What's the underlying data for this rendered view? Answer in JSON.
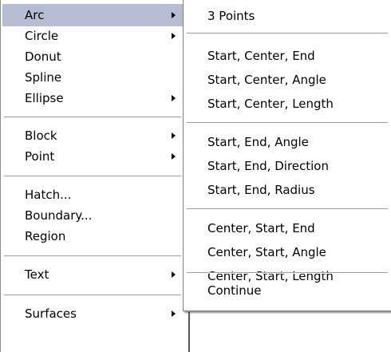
{
  "draw_menu": {
    "items": [
      {
        "label": "Arc",
        "submenu": true,
        "selected": true
      },
      {
        "label": "Circle",
        "submenu": true
      },
      {
        "label": "Donut"
      },
      {
        "label": "Spline"
      },
      {
        "label": "Ellipse",
        "submenu": true
      },
      {
        "label": "Block",
        "submenu": true
      },
      {
        "label": "Point",
        "submenu": true
      },
      {
        "label": "Hatch..."
      },
      {
        "label": "Boundary..."
      },
      {
        "label": "Region"
      },
      {
        "label": "Text",
        "submenu": true
      },
      {
        "label": "Surfaces",
        "submenu": true
      }
    ],
    "selected_color": "#b6bdd2"
  },
  "arc_submenu": {
    "items": [
      {
        "label": "3 Points"
      },
      {
        "label": "Start, Center, End"
      },
      {
        "label": "Start, Center, Angle"
      },
      {
        "label": "Start, Center, Length"
      },
      {
        "label": "Start, End, Angle"
      },
      {
        "label": "Start, End, Direction"
      },
      {
        "label": "Start, End, Radius"
      },
      {
        "label": "Center, Start, End"
      },
      {
        "label": "Center, Start, Angle"
      },
      {
        "label": "Center, Start, Length"
      },
      {
        "label": "Continue"
      }
    ]
  }
}
